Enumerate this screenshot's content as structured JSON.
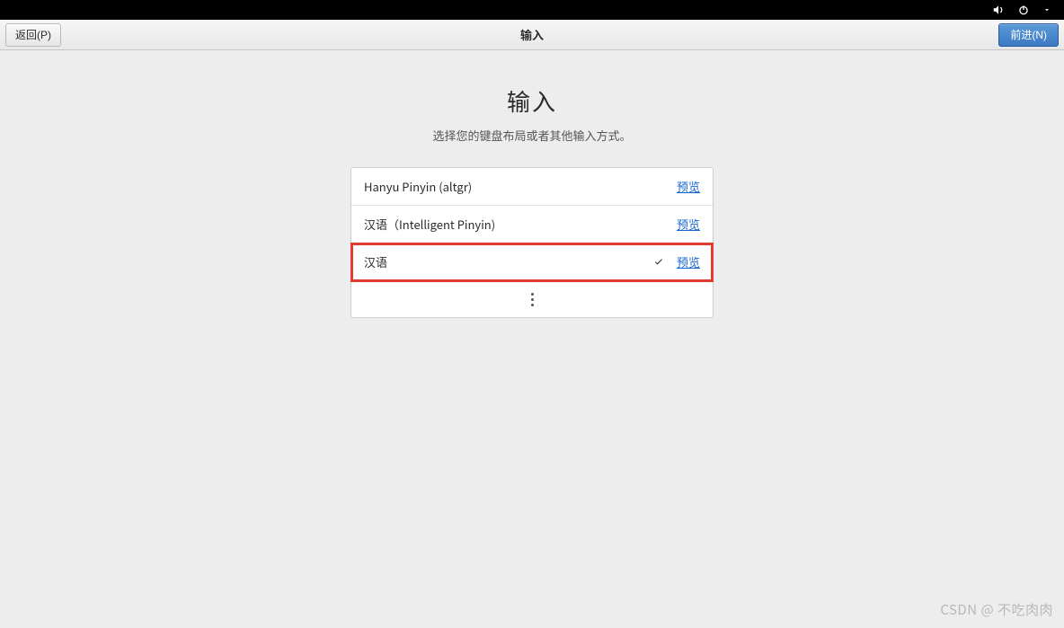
{
  "header": {
    "back_label": "返回(P)",
    "title": "输入",
    "forward_label": "前进(N)"
  },
  "page": {
    "title": "输入",
    "subtitle": "选择您的键盘布局或者其他输入方式。"
  },
  "input_list": {
    "preview_label": "预览",
    "items": [
      {
        "label": "Hanyu Pinyin (altgr)",
        "selected": false
      },
      {
        "label": "汉语（Intelligent Pinyin)",
        "selected": false
      },
      {
        "label": "汉语",
        "selected": true
      }
    ]
  },
  "watermark": "CSDN @ 不吃肉肉"
}
